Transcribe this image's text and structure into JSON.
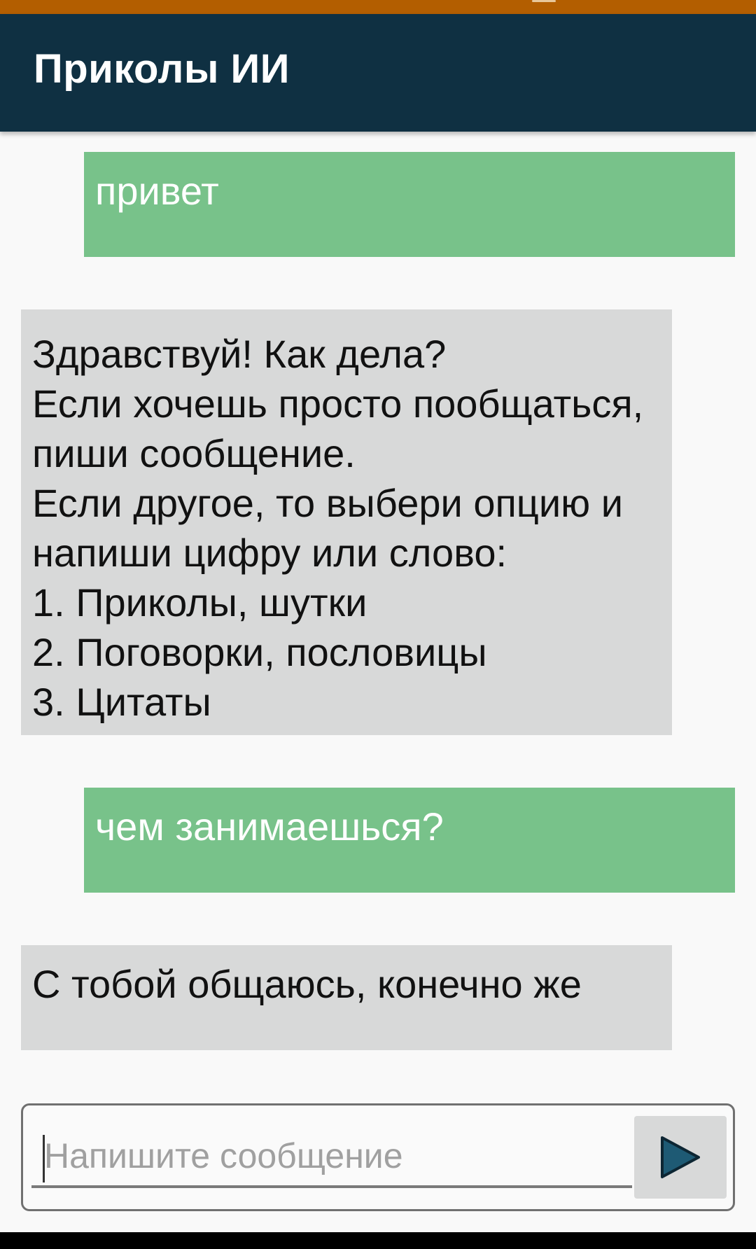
{
  "app": {
    "title": "Приколы ИИ"
  },
  "colors": {
    "status_bar": "#b35e00",
    "app_bar": "#0f3042",
    "user_bubble": "#78c28a",
    "bot_bubble": "#d8d9d9",
    "send_icon": "#1e5a74"
  },
  "messages": [
    {
      "sender": "user",
      "text": "привет"
    },
    {
      "sender": "bot",
      "text": "Здравствуй! Как дела?\nЕсли хочешь просто пообщаться, пиши сообщение.\nЕсли другое, то выбери опцию и напиши цифру или слово:\n1. Приколы, шутки\n2. Поговорки, пословицы\n3. Цитаты"
    },
    {
      "sender": "user",
      "text": "чем занимаешься?"
    },
    {
      "sender": "bot",
      "text": "С тобой общаюсь, конечно же"
    }
  ],
  "composer": {
    "value": "",
    "placeholder": "Напишите сообщение",
    "send_icon": "play-triangle-icon"
  }
}
